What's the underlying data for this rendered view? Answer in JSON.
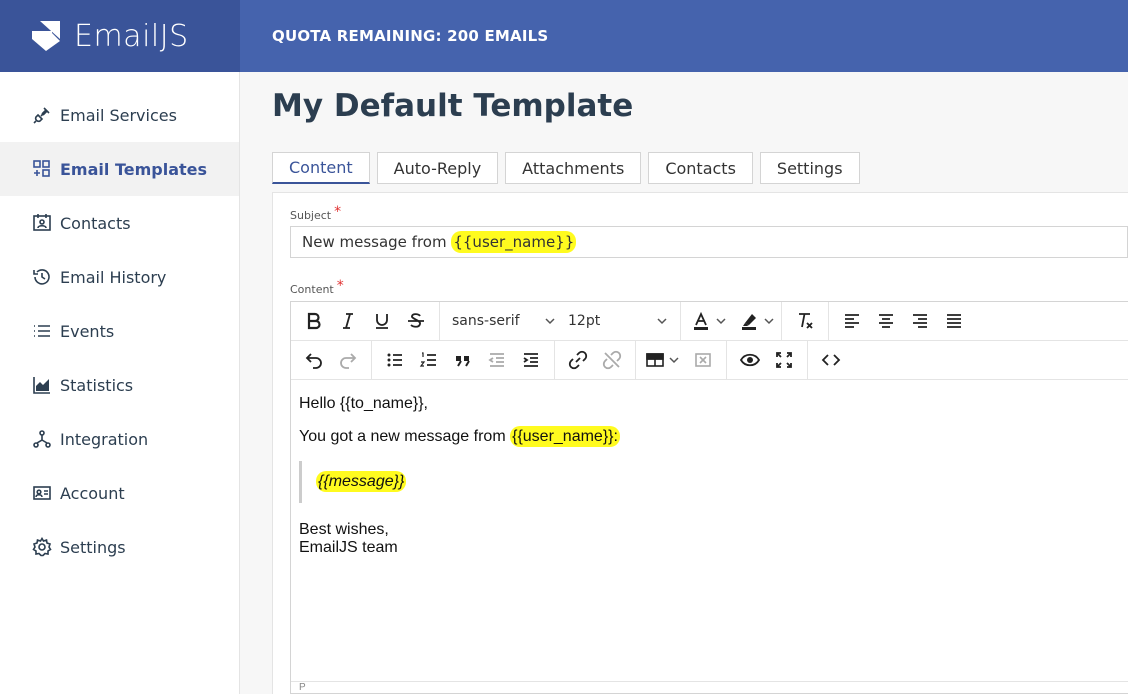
{
  "brand": {
    "name": "EmailJS"
  },
  "topbar": {
    "quota_text": "QUOTA REMAINING: 200 EMAILS"
  },
  "sidebar": {
    "items": [
      {
        "label": "Email Services",
        "icon": "plug-icon"
      },
      {
        "label": "Email Templates",
        "icon": "templates-icon",
        "active": true
      },
      {
        "label": "Contacts",
        "icon": "contacts-icon"
      },
      {
        "label": "Email History",
        "icon": "history-icon"
      },
      {
        "label": "Events",
        "icon": "list-icon"
      },
      {
        "label": "Statistics",
        "icon": "chart-icon"
      },
      {
        "label": "Integration",
        "icon": "integration-icon"
      },
      {
        "label": "Account",
        "icon": "id-card-icon"
      },
      {
        "label": "Settings",
        "icon": "gear-icon"
      }
    ]
  },
  "page": {
    "title": "My Default Template"
  },
  "tabs": [
    {
      "label": "Content",
      "active": true
    },
    {
      "label": "Auto-Reply"
    },
    {
      "label": "Attachments"
    },
    {
      "label": "Contacts"
    },
    {
      "label": "Settings"
    }
  ],
  "subject": {
    "label": "Subject",
    "required_mark": "*",
    "value_prefix": "New message from ",
    "value_variable": "{{user_name}}"
  },
  "content": {
    "label": "Content",
    "required_mark": "*",
    "toolbar": {
      "font_family": "sans-serif",
      "font_size": "12pt"
    },
    "body": {
      "greeting": "Hello {{to_name}},",
      "intro_prefix": "You got a new message from ",
      "intro_variable": "{{user_name}}:",
      "quote": "{{message}}",
      "signoff_line1": "Best wishes,",
      "signoff_line2": "EmailJS team"
    },
    "statusbar": "P"
  },
  "colors": {
    "brand_dark": "#3a5499",
    "brand": "#4563ad",
    "highlight": "#fffb1f",
    "required": "#e03131"
  }
}
